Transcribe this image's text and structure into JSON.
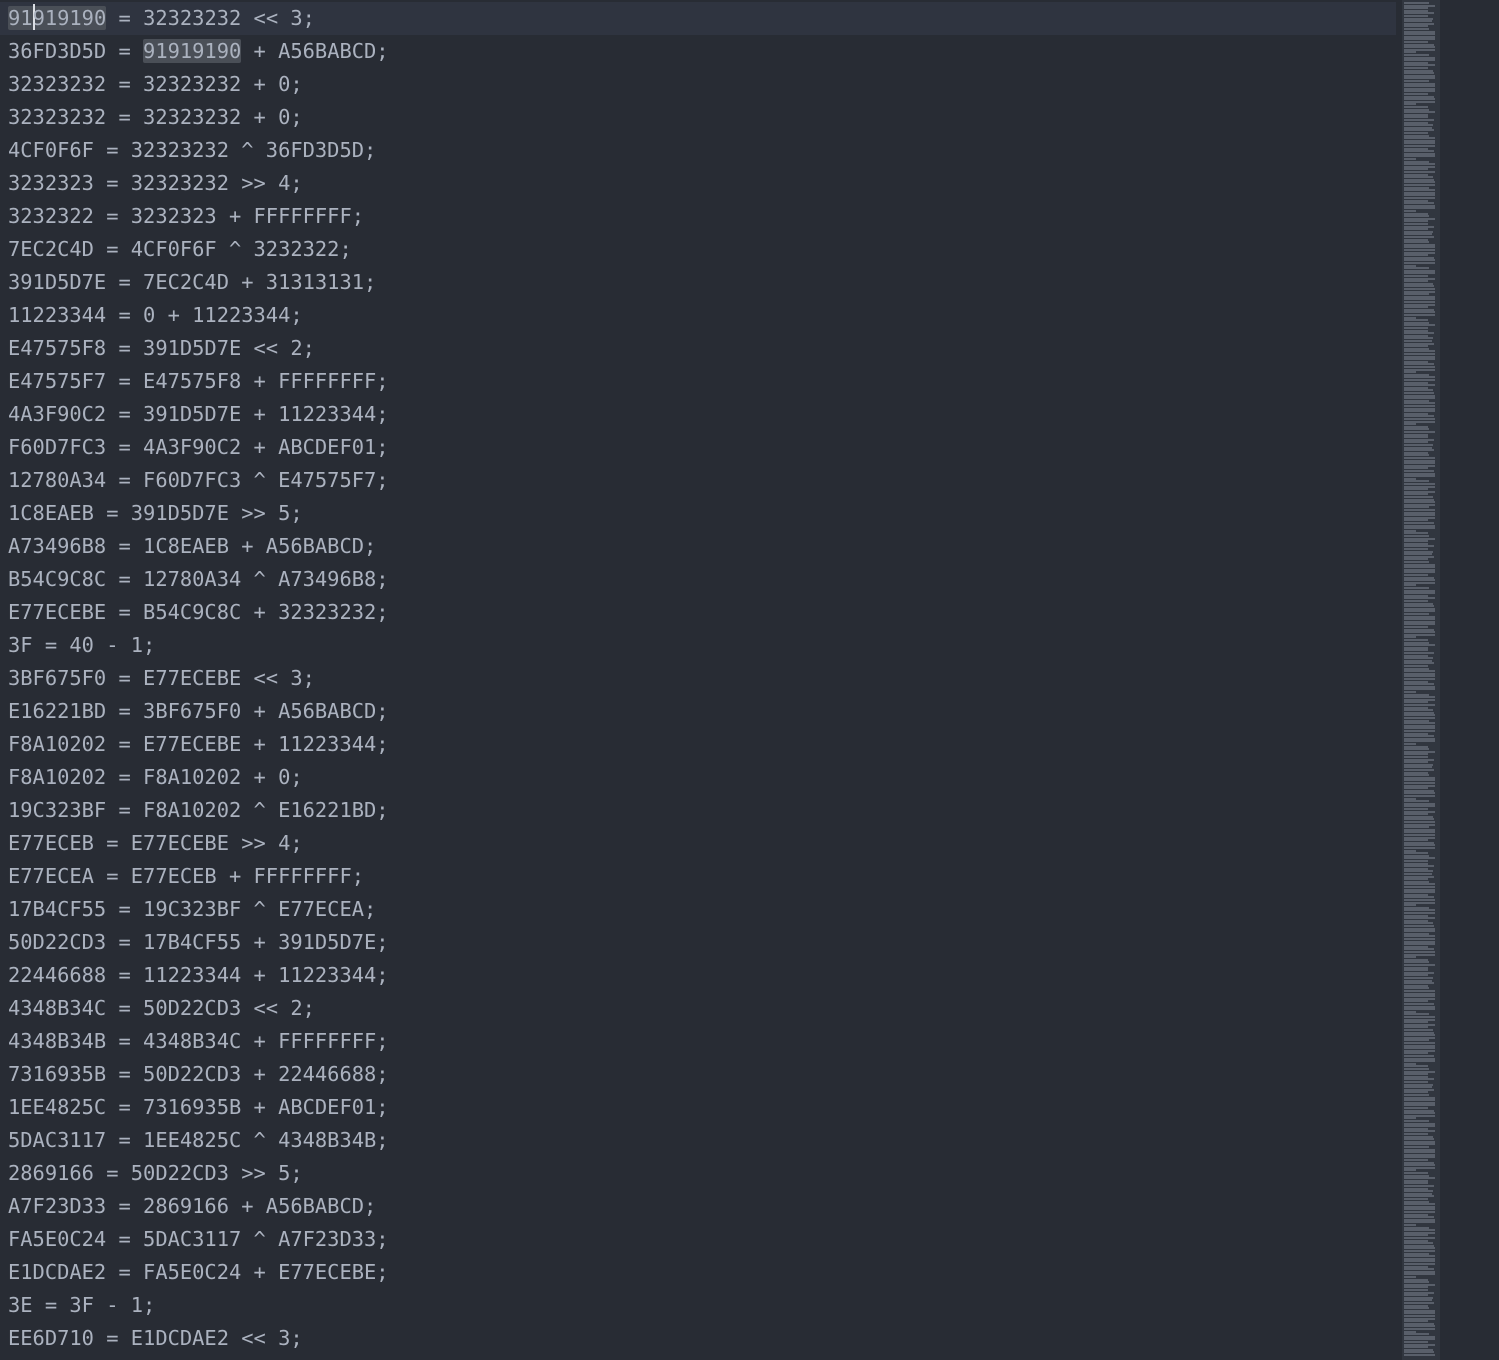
{
  "editor": {
    "cursor_line": 0,
    "selection_text": "91919190",
    "lines": [
      "91919190 = 32323232 << 3;",
      "36FD3D5D = 91919190 + A56BABCD;",
      "32323232 = 32323232 + 0;",
      "32323232 = 32323232 + 0;",
      "4CF0F6F = 32323232 ^ 36FD3D5D;",
      "3232323 = 32323232 >> 4;",
      "3232322 = 3232323 + FFFFFFFF;",
      "7EC2C4D = 4CF0F6F ^ 3232322;",
      "391D5D7E = 7EC2C4D + 31313131;",
      "11223344 = 0 + 11223344;",
      "E47575F8 = 391D5D7E << 2;",
      "E47575F7 = E47575F8 + FFFFFFFF;",
      "4A3F90C2 = 391D5D7E + 11223344;",
      "F60D7FC3 = 4A3F90C2 + ABCDEF01;",
      "12780A34 = F60D7FC3 ^ E47575F7;",
      "1C8EAEB = 391D5D7E >> 5;",
      "A73496B8 = 1C8EAEB + A56BABCD;",
      "B54C9C8C = 12780A34 ^ A73496B8;",
      "E77ECEBE = B54C9C8C + 32323232;",
      "3F = 40 - 1;",
      "3BF675F0 = E77ECEBE << 3;",
      "E16221BD = 3BF675F0 + A56BABCD;",
      "F8A10202 = E77ECEBE + 11223344;",
      "F8A10202 = F8A10202 + 0;",
      "19C323BF = F8A10202 ^ E16221BD;",
      "E77ECEB = E77ECEBE >> 4;",
      "E77ECEA = E77ECEB + FFFFFFFF;",
      "17B4CF55 = 19C323BF ^ E77ECEA;",
      "50D22CD3 = 17B4CF55 + 391D5D7E;",
      "22446688 = 11223344 + 11223344;",
      "4348B34C = 50D22CD3 << 2;",
      "4348B34B = 4348B34C + FFFFFFFF;",
      "7316935B = 50D22CD3 + 22446688;",
      "1EE4825C = 7316935B + ABCDEF01;",
      "5DAC3117 = 1EE4825C ^ 4348B34B;",
      "2869166 = 50D22CD3 >> 5;",
      "A7F23D33 = 2869166 + A56BABCD;",
      "FA5E0C24 = 5DAC3117 ^ A7F23D33;",
      "E1DCDAE2 = FA5E0C24 + E77ECEBE;",
      "3E = 3F - 1;",
      "EE6D710 = E1DCDAE2 << 3;"
    ]
  },
  "colors": {
    "background": "#282c34",
    "text": "#abb2bf",
    "current_line": "#2f3440",
    "selection_highlight": "#4a4f57",
    "cursor": "#dcdfe4"
  }
}
